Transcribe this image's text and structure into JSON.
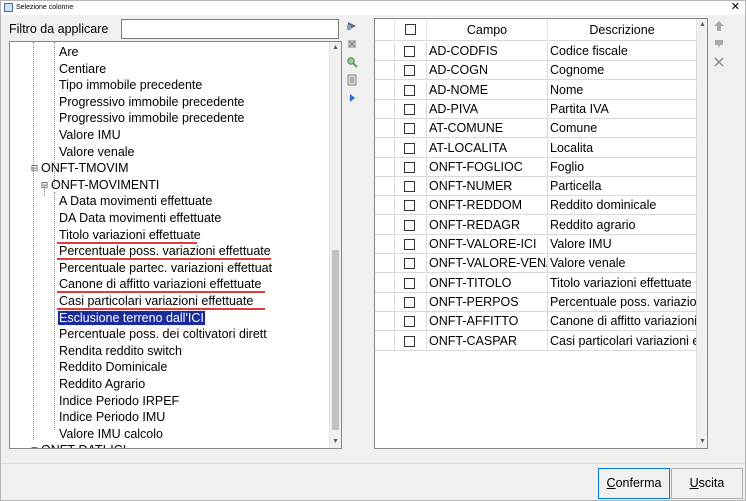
{
  "window": {
    "title": "Selezione colonne",
    "close_glyph": "✕"
  },
  "filter": {
    "label": "Filtro da applicare",
    "value": "",
    "placeholder": ""
  },
  "tree": {
    "rows": [
      {
        "text": "Are"
      },
      {
        "text": "Centiare"
      },
      {
        "text": "Tipo immobile precedente"
      },
      {
        "text": "Progressivo immobile precedente"
      },
      {
        "text": "Progressivo immobile precedente"
      },
      {
        "text": "Valore IMU"
      },
      {
        "text": "Valore venale"
      },
      {
        "text": "ONFT-TMOVIM",
        "expander": "⊟"
      },
      {
        "text": "ONFT-MOVIMENTI",
        "expander": "⊟"
      },
      {
        "text": "A Data movimenti effettuate"
      },
      {
        "text": "DA Data movimenti effettuate"
      },
      {
        "text": "Titolo variazioni effettuate"
      },
      {
        "text": "Percentuale  poss. variazioni effettuate"
      },
      {
        "text": "Percentuale partec. variazioni effettuat"
      },
      {
        "text": "Canone di affitto variazioni effettuate"
      },
      {
        "text": "Casi particolari variazioni effettuate"
      },
      {
        "text": "Esclusione terreno dall'ICI"
      },
      {
        "text": "Percentuale poss. dei coltivatori dirett"
      },
      {
        "text": "Rendita reddito switch"
      },
      {
        "text": "Reddito Dominicale"
      },
      {
        "text": "Reddito Agrario"
      },
      {
        "text": "Indice Periodo IRPEF"
      },
      {
        "text": "Indice Periodo IMU"
      },
      {
        "text": "Valore IMU calcolo"
      },
      {
        "text": "ONFT-DATI-ICI",
        "expander": "⊞"
      }
    ]
  },
  "grid": {
    "headers": {
      "campo": "Campo",
      "descrizione": "Descrizione"
    },
    "rows": [
      {
        "campo": "AD-CODFIS",
        "descrizione": "Codice fiscale"
      },
      {
        "campo": "AD-COGN",
        "descrizione": "Cognome"
      },
      {
        "campo": "AD-NOME",
        "descrizione": "Nome"
      },
      {
        "campo": "AD-PIVA",
        "descrizione": "Partita IVA"
      },
      {
        "campo": "AT-COMUNE",
        "descrizione": "Comune"
      },
      {
        "campo": "AT-LOCALITA",
        "descrizione": "Localita"
      },
      {
        "campo": "ONFT-FOGLIOC",
        "descrizione": "Foglio"
      },
      {
        "campo": "ONFT-NUMER",
        "descrizione": "Particella"
      },
      {
        "campo": "ONFT-REDDOM",
        "descrizione": "Reddito dominicale"
      },
      {
        "campo": "ONFT-REDAGR",
        "descrizione": "Reddito agrario"
      },
      {
        "campo": "ONFT-VALORE-ICI",
        "descrizione": "Valore IMU"
      },
      {
        "campo": "ONFT-VALORE-VENALE",
        "descrizione": "Valore venale"
      },
      {
        "campo": "ONFT-TITOLO",
        "descrizione": "Titolo variazioni effettuate"
      },
      {
        "campo": "ONFT-PERPOS",
        "descrizione": "Percentuale  poss. variazioni"
      },
      {
        "campo": "ONFT-AFFITTO",
        "descrizione": "Canone di affitto variazioni"
      },
      {
        "campo": "ONFT-CASPAR",
        "descrizione": "Casi particolari variazioni ef"
      }
    ]
  },
  "buttons": {
    "confirm": {
      "pre": "",
      "mnemonic": "C",
      "post": "onferma"
    },
    "exit": {
      "pre": "",
      "mnemonic": "U",
      "post": "scita"
    }
  },
  "colors": {
    "selection": "#1a2b9c",
    "annotation": "#e03c3c",
    "toolbar_blue": "#2b6cd4"
  }
}
